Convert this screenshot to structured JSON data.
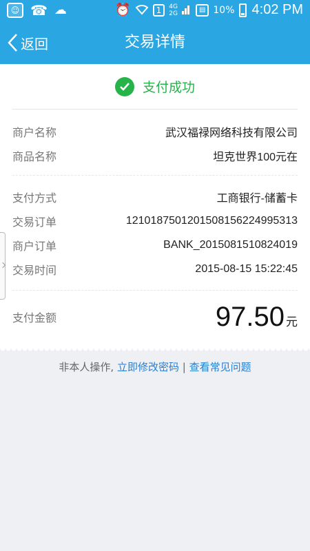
{
  "statusbar": {
    "icons": [
      "app-icon",
      "missed-call-icon",
      "cloud-icon",
      "alarm-icon",
      "wifi-icon",
      "sim-icon",
      "network-icon",
      "signal-icon",
      "save-icon",
      "battery-icon"
    ],
    "network_top": "4G",
    "network_bottom": "2G",
    "sim": "1",
    "battery": "10%",
    "time": "4:02 PM"
  },
  "navbar": {
    "back_label": "返回",
    "title": "交易详情"
  },
  "status": {
    "text": "支付成功"
  },
  "details": [
    {
      "label": "商户名称",
      "value": "武汉福禄网络科技有限公司"
    },
    {
      "label": "商品名称",
      "value": "坦克世界100元在"
    },
    {
      "label": "支付方式",
      "value": "工商银行-储蓄卡"
    },
    {
      "label": "交易订单",
      "value": "1210187501201508156224995313"
    },
    {
      "label": "商户订单",
      "value": "BANK_2015081510824019"
    },
    {
      "label": "交易时间",
      "value": "2015-08-15 15:22:45"
    }
  ],
  "amount": {
    "label": "支付金额",
    "value": "97.50",
    "unit": "元"
  },
  "footer": {
    "prefix": "非本人操作, ",
    "change_password": "立即修改密码",
    "separator": " | ",
    "faq": "查看常见问题"
  },
  "colors": {
    "primary": "#2aa6e3",
    "success": "#25b34a",
    "link": "#2a7fcf"
  }
}
